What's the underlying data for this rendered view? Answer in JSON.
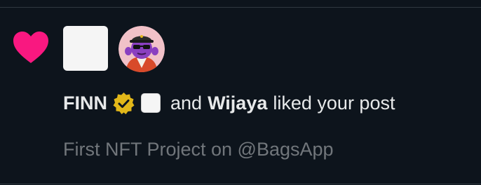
{
  "notification": {
    "type_icon": "heart-icon",
    "actor1_name": "FINN",
    "actor1_badge": "verified-icon",
    "connector": "and",
    "actor2_name": "Wijaya",
    "action": "liked your post",
    "post_preview": "First NFT Project on @BagsApp"
  },
  "colors": {
    "background": "#0d141c",
    "heart": "#f91880",
    "text_primary": "#e7e9ea",
    "text_secondary": "#71767b",
    "verified_gold": "#e2b719"
  }
}
